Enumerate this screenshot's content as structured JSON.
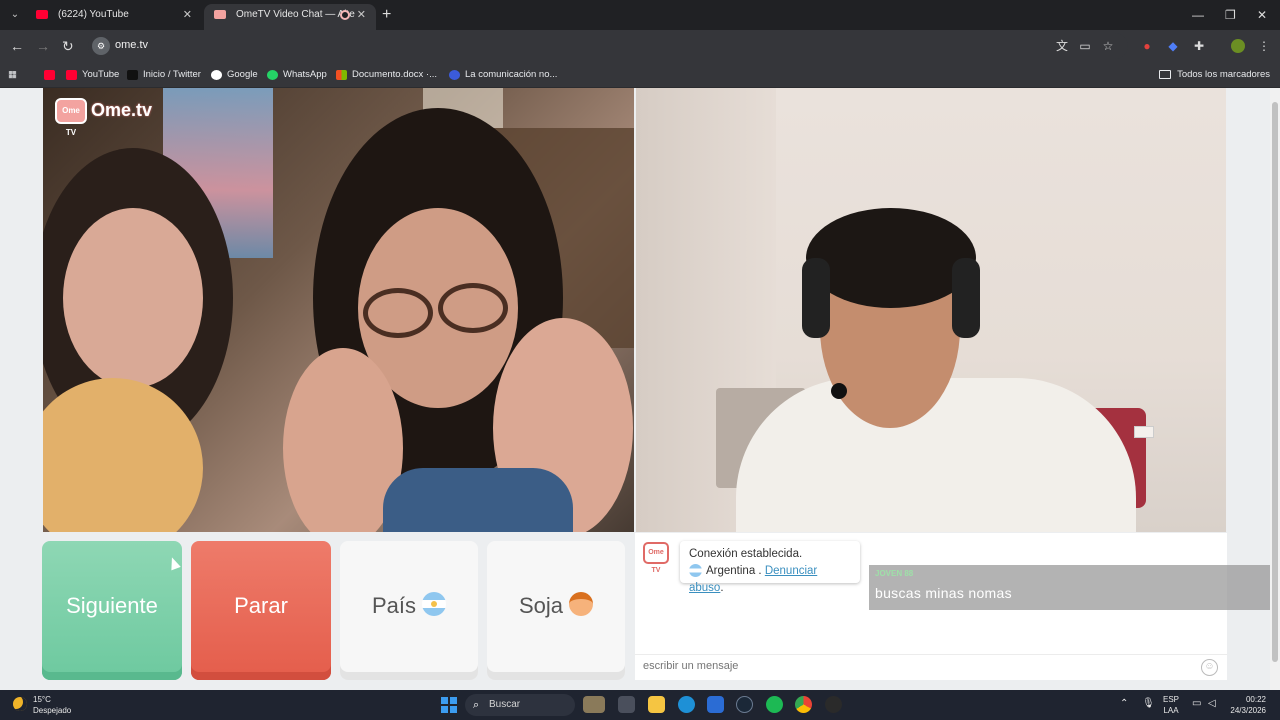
{
  "browser": {
    "tabs": [
      {
        "title": "(6224) YouTube",
        "favicon": "youtube-icon",
        "color": "#ff0033"
      },
      {
        "title": "OmeTV Video Chat — Alte",
        "favicon": "ometv-icon",
        "color": "#f3a3a0",
        "active": true
      }
    ],
    "new_tab": "+",
    "url": "ome.tv",
    "bookmarks": [
      {
        "label": "",
        "icon": "youtube-icon",
        "color": "#ff0033"
      },
      {
        "label": "YouTube",
        "icon": "youtube-icon",
        "color": "#ff0033"
      },
      {
        "label": "Inicio / Twitter",
        "icon": "x-icon",
        "color": "#111111"
      },
      {
        "label": "Google",
        "icon": "google-icon",
        "color": "#4285f4"
      },
      {
        "label": "WhatsApp",
        "icon": "whatsapp-icon",
        "color": "#25d366"
      },
      {
        "label": "Documento.docx ·...",
        "icon": "office-icon",
        "color": "#f25022"
      },
      {
        "label": "La comunicación no...",
        "icon": "wordpress-icon",
        "color": "#3b5bdb"
      }
    ],
    "all_bookmarks": "Todos los marcadores"
  },
  "ometv": {
    "logo_badge": "Ome TV",
    "logo_text": "Ome.tv",
    "buttons": {
      "next": "Siguiente",
      "stop": "Parar",
      "country": "País",
      "sex": "Soja"
    },
    "chat": {
      "logo": "Ome TV",
      "system_message": "Conexión establecida.",
      "country": "Argentina",
      "separator": " . ",
      "report_link": "Denunciar abuso",
      "report_suffix": ".",
      "input_placeholder": "escribir un mensaje"
    },
    "caption": {
      "speaker": "JOVEN 88",
      "text": "buscas minas nomas"
    }
  },
  "taskbar": {
    "weather_temp": "15°C",
    "weather_desc": "Despejado",
    "search": "Buscar",
    "lang_top": "ESP",
    "lang_bottom": "LAA",
    "time": "00:22",
    "date": "24/3/2026"
  }
}
